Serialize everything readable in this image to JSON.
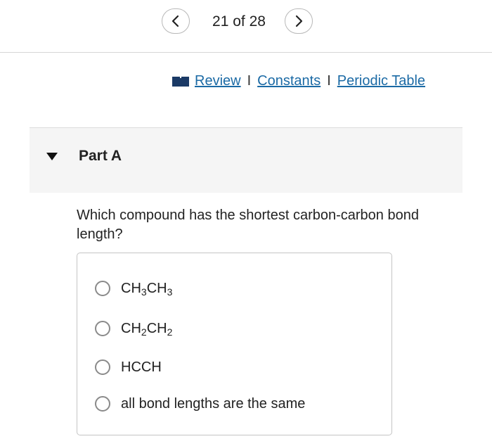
{
  "pager": {
    "text": "21 of 28",
    "prev_icon": "chevron-left-icon",
    "next_icon": "chevron-right-icon"
  },
  "resources": {
    "icon": "book-icon",
    "links": [
      "Review",
      "Constants",
      "Periodic Table"
    ],
    "separator": "I"
  },
  "part": {
    "title": "Part A",
    "expanded": true
  },
  "question": {
    "text": "Which compound has the shortest carbon-carbon bond length?"
  },
  "options": [
    {
      "label": "CH3CH3",
      "parts": [
        "CH",
        "3",
        "CH",
        "3"
      ],
      "selected": false
    },
    {
      "label": "CH2CH2",
      "parts": [
        "CH",
        "2",
        "CH",
        "2"
      ],
      "selected": false
    },
    {
      "label": "HCCH",
      "selected": false
    },
    {
      "label": "all bond lengths are the same",
      "selected": false
    }
  ],
  "colors": {
    "link": "#1b6aa5",
    "part_header_bg": "#f5f5f5",
    "border": "#c4c4c4",
    "radio_border": "#8a8a8a"
  }
}
